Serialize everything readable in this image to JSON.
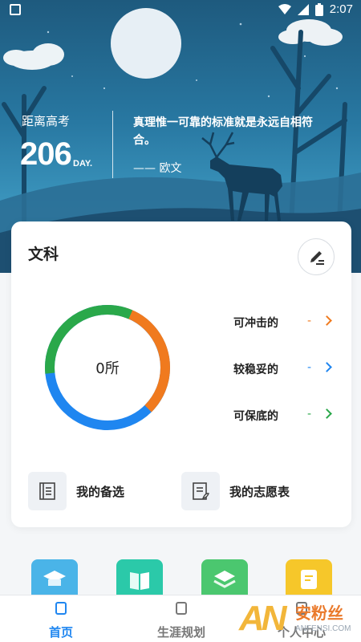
{
  "status_bar": {
    "time": "2:07"
  },
  "header": {
    "countdown_label": "距离高考",
    "countdown_value": "206",
    "countdown_unit": "DAY.",
    "quote": "真理惟一可靠的标准就是永远自相符合。",
    "quote_author": "—— 欧文"
  },
  "card": {
    "title": "文科",
    "donut_center": "0所",
    "donut_colors": [
      "#2aa84a",
      "#f07a1e",
      "#1f86f0"
    ],
    "categories": [
      {
        "label": "可冲击的",
        "value": "-",
        "color": "#f07a1e"
      },
      {
        "label": "较稳妥的",
        "value": "-",
        "color": "#1f86f0"
      },
      {
        "label": "可保底的",
        "value": "-",
        "color": "#2aa84a"
      }
    ],
    "tiles": [
      {
        "label": "我的备选",
        "icon": "list-doc-icon"
      },
      {
        "label": "我的志愿表",
        "icon": "form-doc-icon"
      }
    ]
  },
  "apps": [
    {
      "icon": "graduation-cap-icon",
      "color": "#4ab4e8"
    },
    {
      "icon": "book-icon",
      "color": "#2bc9a9"
    },
    {
      "icon": "layers-icon",
      "color": "#4bc76f"
    },
    {
      "icon": "notes-icon",
      "color": "#f6c72a"
    }
  ],
  "nav": {
    "items": [
      {
        "label": "首页",
        "icon": "home-icon",
        "active": true
      },
      {
        "label": "生涯规划",
        "icon": "planner-icon",
        "active": false
      },
      {
        "label": "个人中心",
        "icon": "user-icon",
        "active": false
      }
    ],
    "active_color": "#1f86f0",
    "inactive_color": "#777"
  },
  "watermark": {
    "brand": "AN",
    "name": "安粉丝",
    "url": "ANFENSI.COM"
  }
}
